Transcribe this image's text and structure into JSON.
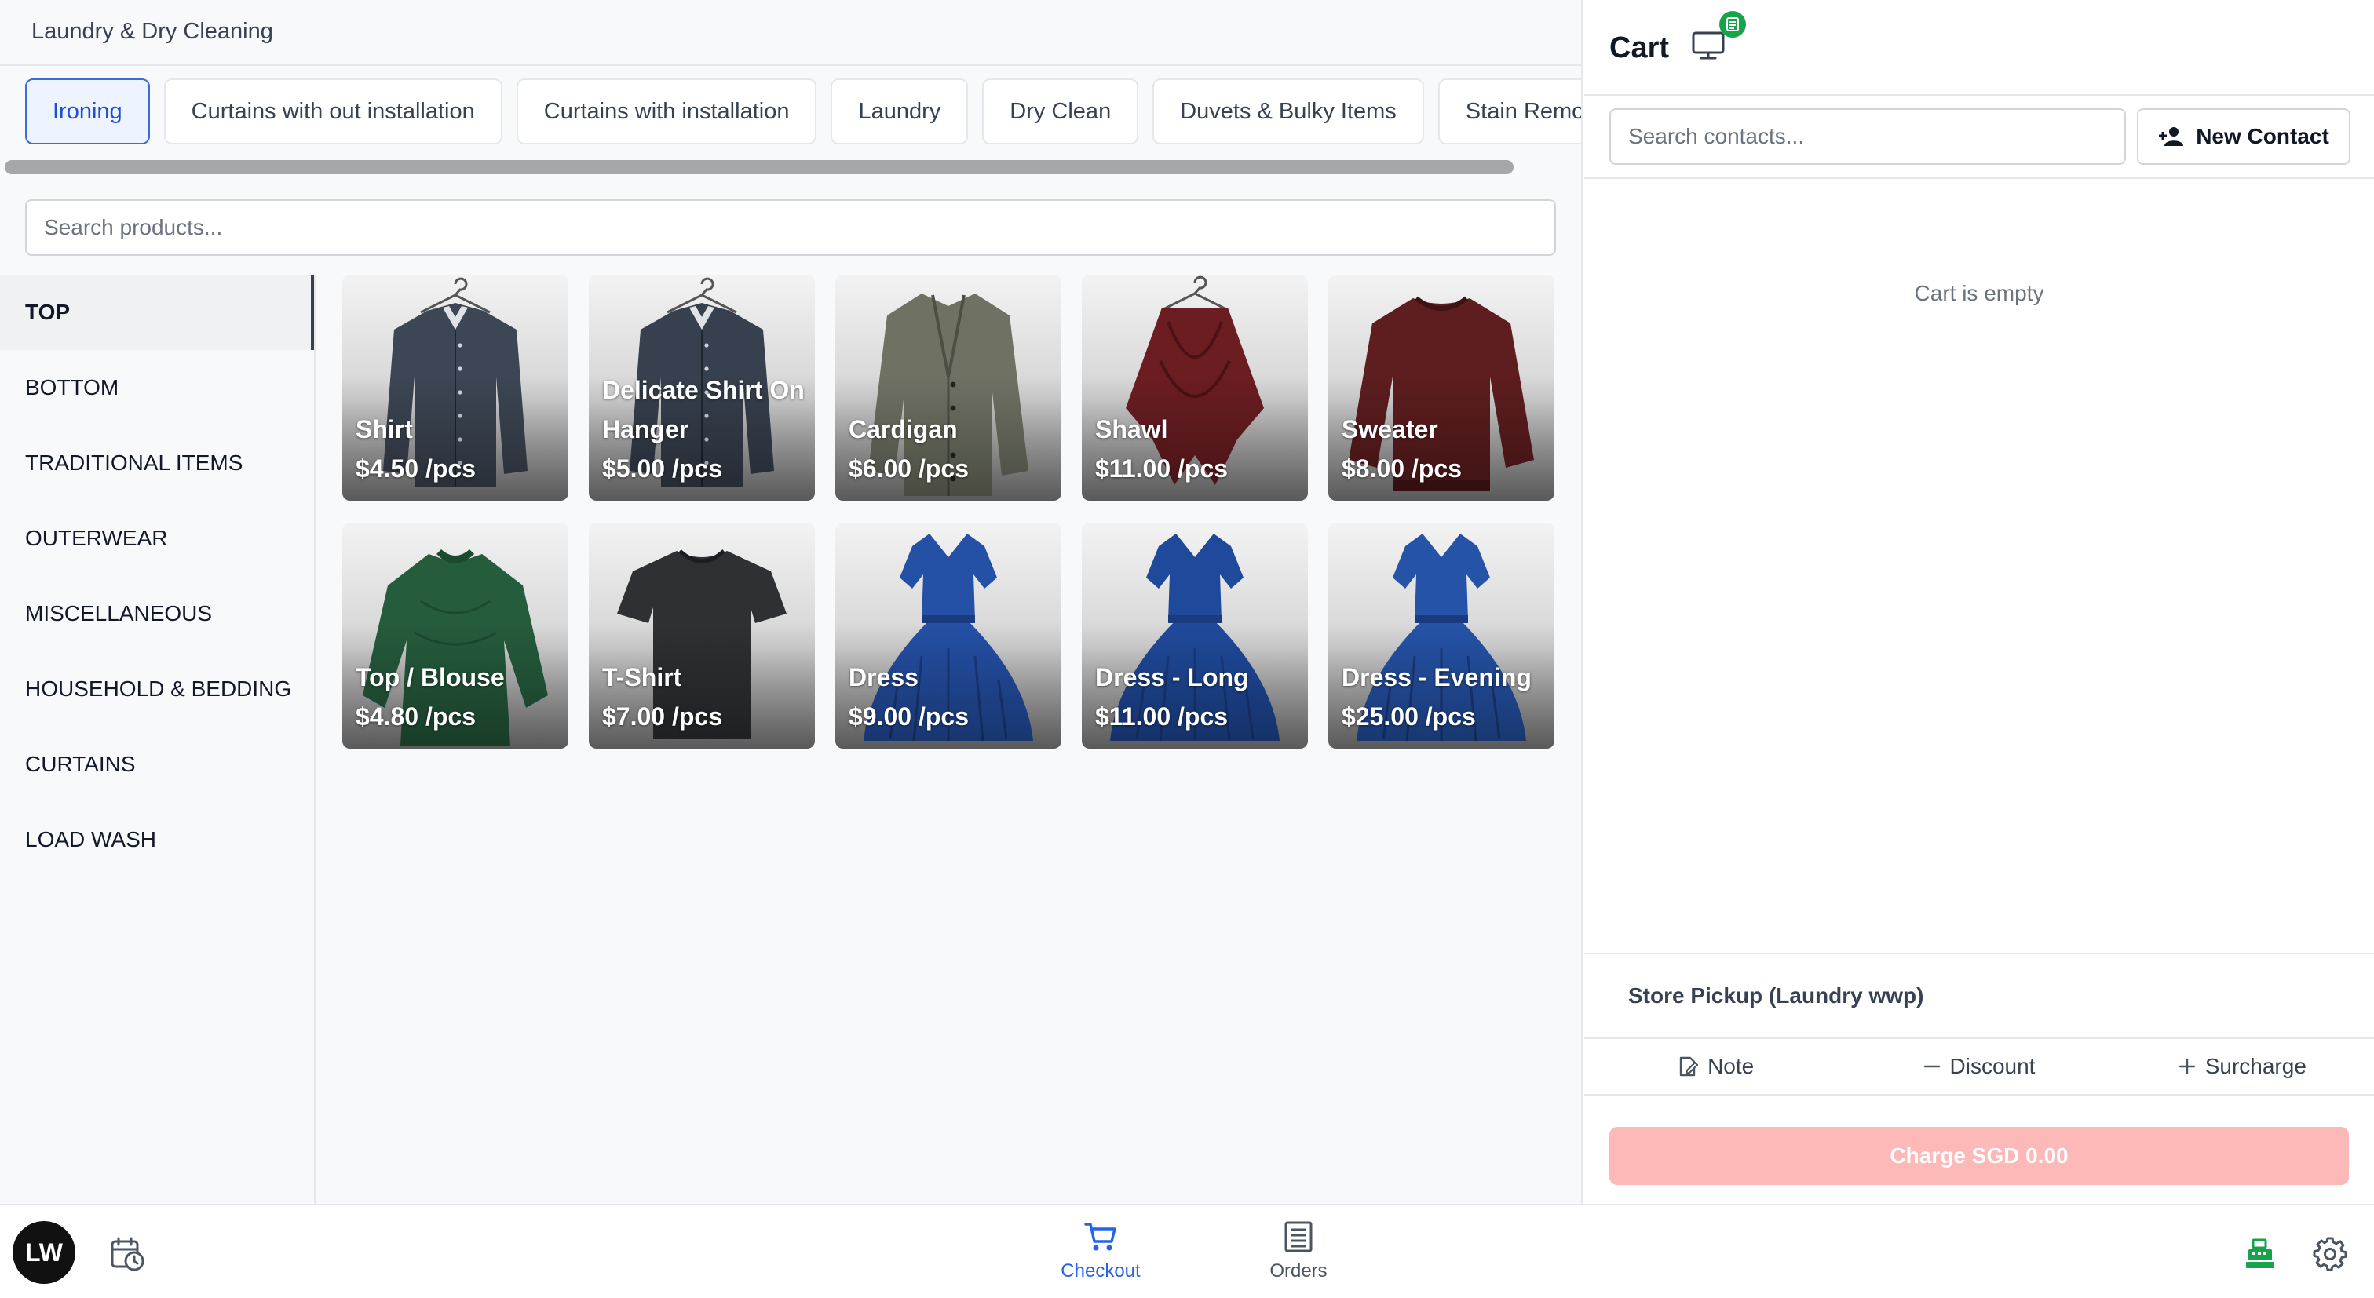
{
  "store": {
    "title": "Laundry & Dry Cleaning"
  },
  "tabs": [
    {
      "label": "Ironing",
      "active": true
    },
    {
      "label": "Curtains with out installation",
      "active": false
    },
    {
      "label": "Curtains with installation",
      "active": false
    },
    {
      "label": "Laundry",
      "active": false
    },
    {
      "label": "Dry Clean",
      "active": false
    },
    {
      "label": "Duvets & Bulky Items",
      "active": false
    },
    {
      "label": "Stain Removal",
      "active": false
    }
  ],
  "product_search": {
    "placeholder": "Search products..."
  },
  "categories": [
    {
      "label": "TOP",
      "active": true
    },
    {
      "label": "BOTTOM",
      "active": false
    },
    {
      "label": "TRADITIONAL ITEMS",
      "active": false
    },
    {
      "label": "OUTERWEAR",
      "active": false
    },
    {
      "label": "MISCELLANEOUS",
      "active": false
    },
    {
      "label": "HOUSEHOLD & BEDDING",
      "active": false
    },
    {
      "label": "CURTAINS",
      "active": false
    },
    {
      "label": "LOAD WASH",
      "active": false
    }
  ],
  "products": [
    {
      "name": "Shirt",
      "price": "$4.50 /pcs",
      "image": "shirt-on-hanger",
      "color": "#3d4654"
    },
    {
      "name": "Delicate Shirt On Hanger",
      "price": "$5.00 /pcs",
      "image": "shirt-on-hanger",
      "color": "#37404e"
    },
    {
      "name": "Cardigan",
      "price": "$6.00 /pcs",
      "image": "cardigan",
      "color": "#6f7263"
    },
    {
      "name": "Shawl",
      "price": "$11.00 /pcs",
      "image": "shawl",
      "color": "#6b1d22"
    },
    {
      "name": "Sweater",
      "price": "$8.00 /pcs",
      "image": "sweater",
      "color": "#5e1d1f"
    },
    {
      "name": "Top / Blouse",
      "price": "$4.80 /pcs",
      "image": "blouse",
      "color": "#255c3c"
    },
    {
      "name": "T-Shirt",
      "price": "$7.00 /pcs",
      "image": "tshirt",
      "color": "#2e3034"
    },
    {
      "name": "Dress",
      "price": "$9.00 /pcs",
      "image": "dress",
      "color": "#2450a6"
    },
    {
      "name": "Dress - Long",
      "price": "$11.00 /pcs",
      "image": "dress",
      "color": "#1f4a9c"
    },
    {
      "name": "Dress - Evening",
      "price": "$25.00 /pcs",
      "image": "dress",
      "color": "#2553a8"
    }
  ],
  "cart": {
    "title": "Cart",
    "contact_search_placeholder": "Search contacts...",
    "new_contact_label": "New Contact",
    "empty_text": "Cart is empty",
    "pickup_label": "Store Pickup (Laundry wwp)",
    "note_label": "Note",
    "discount_label": "Discount",
    "surcharge_label": "Surcharge",
    "charge_label": "Charge SGD 0.00"
  },
  "bottom_nav": {
    "avatar_initials": "LW",
    "checkout_label": "Checkout",
    "orders_label": "Orders"
  },
  "colors": {
    "accent": "#2563eb",
    "charge_disabled": "#fdb8b8",
    "status_green": "#16a34a"
  },
  "icons": [
    "history-icon",
    "cart-icon",
    "orders-icon",
    "register-icon",
    "settings-icon",
    "display-icon",
    "add-person-icon",
    "note-icon",
    "minus-icon",
    "plus-icon"
  ]
}
